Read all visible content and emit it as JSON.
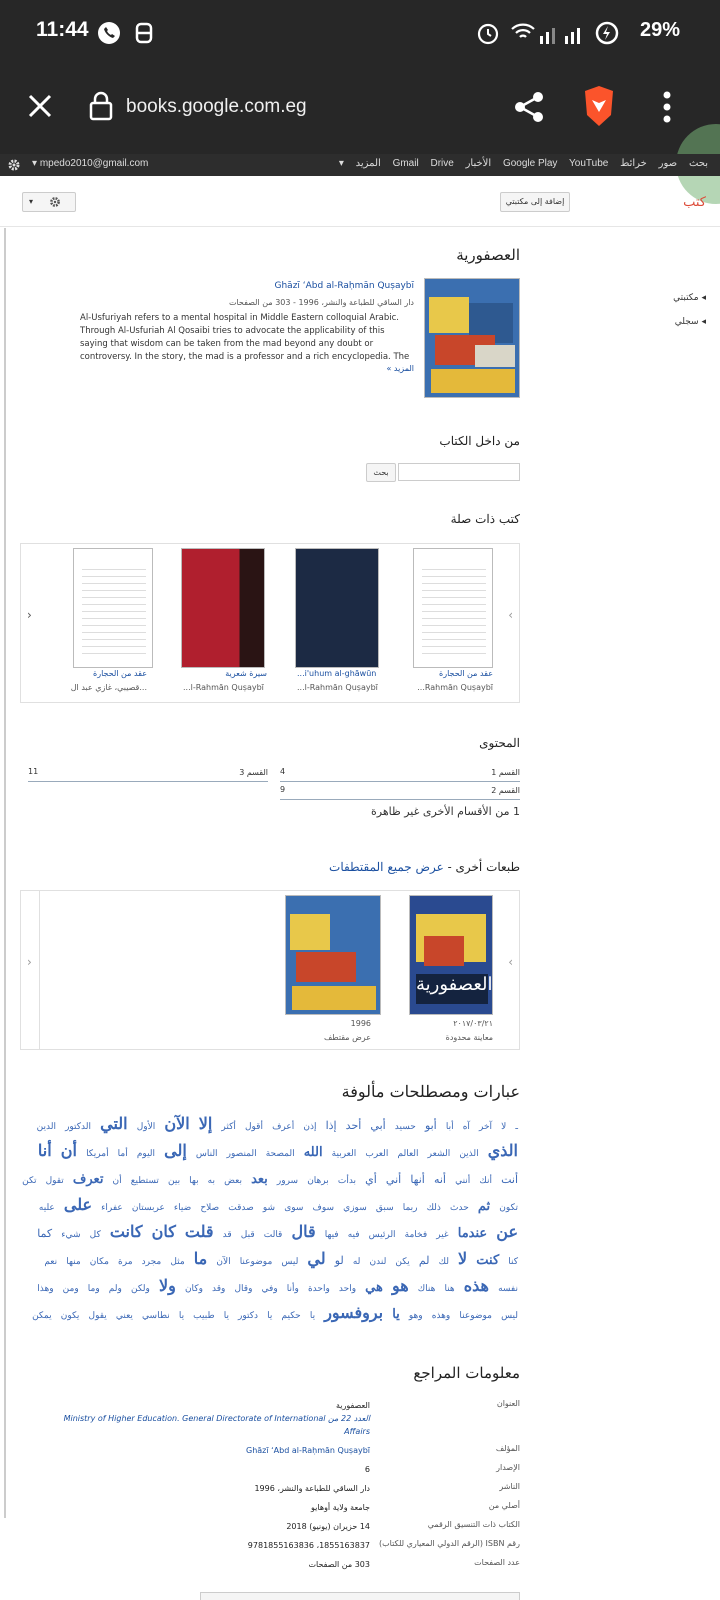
{
  "status": {
    "time": "11:44",
    "battery": "29%"
  },
  "browser": {
    "url": "books.google.com.eg"
  },
  "gbar": {
    "account": "mpedo2010@gmail.com",
    "items": [
      "بحث",
      "صور",
      "خرائط",
      "Google Play",
      "YouTube",
      "الأخبار",
      "Gmail",
      "Drive",
      "المزيد"
    ]
  },
  "header": {
    "logo": "كتب",
    "add_button": "إضافة إلى مكتبتي"
  },
  "sidebar": {
    "my_library": "مكتبتي",
    "history": "سجلي"
  },
  "book": {
    "title": "العصفورية",
    "author": "Ghāzī ʻAbd al-Raḥmān Quṣaybī",
    "meta": "دار الساقي للطباعة والنشر، 1996 - 303 من الصفحات",
    "description": "Al-Usfuriyah refers to a mental hospital in Middle Eastern colloquial Arabic. Through Al-Usfuriah Al Qosaibi tries to advocate the applicability of this saying that wisdom can be taken from the mad beyond any doubt or controversy. In the story, the mad is a professor and a rich encyclopedia. The mad is also a life",
    "more": "المزيد »"
  },
  "inside": {
    "heading": "من داخل الكتاب",
    "search_button": "بحث"
  },
  "related": {
    "heading": "كتب ذات صلة",
    "items": [
      {
        "title": "عقد من الحجارة",
        "author": "...Rahmān Quṣaybī"
      },
      {
        "title": "...i'uhum al-ghāwūn",
        "author": "...l-Rahmān Quṣaybī"
      },
      {
        "title": "سيرة شعرية",
        "author": "...l-Rahmān Quṣaybī"
      },
      {
        "title": "عقد من الحجارة",
        "author": "...قصيبي، غازي عبد ال"
      }
    ]
  },
  "contents": {
    "heading": "المحتوى",
    "rows": [
      {
        "label": "القسم 1",
        "page": "4"
      },
      {
        "label": "القسم 2",
        "page": "9"
      },
      {
        "label": "القسم 3",
        "page": "11"
      }
    ],
    "other": "1 من الأقسام الأخرى غير ظاهرة"
  },
  "editions": {
    "heading": "طبعات أخرى - ",
    "link": "عرض جميع المقتطفات",
    "items": [
      {
        "date": "٢٠١٧/٠٣/٢١",
        "note": "معاينة محدودة"
      },
      {
        "date": "1996",
        "note": "عرض مقتطف"
      }
    ]
  },
  "phrases": {
    "heading": "عبارات ومصطلحات مألوفة",
    "words": [
      [
        "ـ",
        0
      ],
      [
        "لا",
        0
      ],
      [
        "آخر",
        0
      ],
      [
        "آه",
        0
      ],
      [
        "أبا",
        0
      ],
      [
        "أبو",
        1
      ],
      [
        "حسيد",
        0
      ],
      [
        "أبي",
        1
      ],
      [
        "أحد",
        1
      ],
      [
        "إذا",
        1
      ],
      [
        "إذن",
        0
      ],
      [
        "أعرف",
        0
      ],
      [
        "أقول",
        0
      ],
      [
        "أكثر",
        0
      ],
      [
        "إلا",
        3
      ],
      [
        "الآن",
        3
      ],
      [
        "الأول",
        0
      ],
      [
        "التي",
        3
      ],
      [
        "الدكتور",
        0
      ],
      [
        "الدين",
        0
      ],
      [
        "الذي",
        3
      ],
      [
        "الذين",
        0
      ],
      [
        "الشعر",
        0
      ],
      [
        "العالم",
        0
      ],
      [
        "العرب",
        0
      ],
      [
        "العربية",
        0
      ],
      [
        "الله",
        2
      ],
      [
        "المصحة",
        0
      ],
      [
        "المنصور",
        0
      ],
      [
        "الناس",
        0
      ],
      [
        "إلى",
        3
      ],
      [
        "اليوم",
        0
      ],
      [
        "أما",
        0
      ],
      [
        "أمريكا",
        0
      ],
      [
        "أن",
        3
      ],
      [
        "أنا",
        3
      ],
      [
        "أنت",
        1
      ],
      [
        "أنك",
        0
      ],
      [
        "أنني",
        0
      ],
      [
        "أنه",
        1
      ],
      [
        "أنها",
        1
      ],
      [
        "أني",
        1
      ],
      [
        "أي",
        1
      ],
      [
        "بدأت",
        0
      ],
      [
        "برهان",
        0
      ],
      [
        "سرور",
        0
      ],
      [
        "بعد",
        2
      ],
      [
        "بعض",
        0
      ],
      [
        "به",
        0
      ],
      [
        "بها",
        0
      ],
      [
        "بين",
        0
      ],
      [
        "تستطيع",
        0
      ],
      [
        "أن",
        0
      ],
      [
        "تعرف",
        2
      ],
      [
        "تقول",
        0
      ],
      [
        "تكن",
        0
      ],
      [
        "تكون",
        0
      ],
      [
        "ثم",
        2
      ],
      [
        "حدث",
        0
      ],
      [
        "ذلك",
        0
      ],
      [
        "ربما",
        0
      ],
      [
        "سبق",
        0
      ],
      [
        "سوزي",
        0
      ],
      [
        "سوف",
        0
      ],
      [
        "سوى",
        0
      ],
      [
        "شو",
        0
      ],
      [
        "صدقت",
        0
      ],
      [
        "صلاح",
        0
      ],
      [
        "ضياء",
        0
      ],
      [
        "عربستان",
        0
      ],
      [
        "عفراء",
        0
      ],
      [
        "على",
        3
      ],
      [
        "عليه",
        0
      ],
      [
        "عن",
        3
      ],
      [
        "عندما",
        2
      ],
      [
        "غير",
        0
      ],
      [
        "فخامة",
        0
      ],
      [
        "الرئيس",
        0
      ],
      [
        "فيه",
        0
      ],
      [
        "فيها",
        0
      ],
      [
        "قال",
        3
      ],
      [
        "قالت",
        0
      ],
      [
        "قبل",
        0
      ],
      [
        "قد",
        0
      ],
      [
        "قلت",
        3
      ],
      [
        "كان",
        3
      ],
      [
        "كانت",
        3
      ],
      [
        "كل",
        0
      ],
      [
        "شيء",
        0
      ],
      [
        "كما",
        1
      ],
      [
        "كنا",
        0
      ],
      [
        "كنت",
        2
      ],
      [
        "لا",
        3
      ],
      [
        "لك",
        0
      ],
      [
        "لم",
        1
      ],
      [
        "يكن",
        0
      ],
      [
        "لندن",
        0
      ],
      [
        "له",
        0
      ],
      [
        "لو",
        1
      ],
      [
        "لي",
        3
      ],
      [
        "ليس",
        0
      ],
      [
        "موضوعنا",
        0
      ],
      [
        "الآن",
        0
      ],
      [
        "ما",
        3
      ],
      [
        "مثل",
        0
      ],
      [
        "مجرد",
        0
      ],
      [
        "مرة",
        0
      ],
      [
        "مكان",
        0
      ],
      [
        "منها",
        0
      ],
      [
        "نعم",
        0
      ],
      [
        "نفسه",
        0
      ],
      [
        "هذه",
        3
      ],
      [
        "هنا",
        0
      ],
      [
        "هناك",
        0
      ],
      [
        "هو",
        3
      ],
      [
        "هي",
        2
      ],
      [
        "واحد",
        0
      ],
      [
        "واحدة",
        0
      ],
      [
        "وأنا",
        0
      ],
      [
        "وفي",
        0
      ],
      [
        "وقال",
        0
      ],
      [
        "وقد",
        0
      ],
      [
        "وكان",
        0
      ],
      [
        "ولا",
        3
      ],
      [
        "ولكن",
        0
      ],
      [
        "ولم",
        0
      ],
      [
        "وما",
        0
      ],
      [
        "ومن",
        0
      ],
      [
        "وهذا",
        0
      ],
      [
        "ليس",
        0
      ],
      [
        "موضوعنا",
        0
      ],
      [
        "وهذه",
        0
      ],
      [
        "وهو",
        0
      ],
      [
        "يا",
        2
      ],
      [
        "بروفسور",
        3
      ],
      [
        "يا",
        0
      ],
      [
        "حكيم",
        0
      ],
      [
        "يا",
        0
      ],
      [
        "دكتور",
        0
      ],
      [
        "يا",
        0
      ],
      [
        "طبيب",
        0
      ],
      [
        "يا",
        0
      ],
      [
        "نطاسي",
        0
      ],
      [
        "يعني",
        0
      ],
      [
        "يقول",
        0
      ],
      [
        "يكون",
        0
      ],
      [
        "يمكن",
        0
      ],
      [
        "يوم",
        0
      ]
    ]
  },
  "references": {
    "heading": "معلومات المراجع",
    "rows": [
      {
        "label": "العنوان",
        "values": [
          "العصفورية",
          "العدد 22 من Ministry of Higher Education. General Directorate of International Affairs"
        ]
      },
      {
        "label": "المؤلف",
        "values": [
          "Ghāzī ʻAbd al-Raḥmān Quṣaybī"
        ]
      },
      {
        "label": "الإصدار",
        "values": [
          "6"
        ]
      },
      {
        "label": "الناشر",
        "values": [
          "دار الساقي للطباعة والنشر، 1996"
        ]
      },
      {
        "label": "أصلي من",
        "values": [
          "جامعة ولاية أوهايو"
        ]
      },
      {
        "label": "الكتاب ذات التنسيق الرقمي",
        "values": [
          "14 حزيران (يونيو) 2018"
        ]
      },
      {
        "label": "رقم ISBN (الرقم الدولي المعياري للكتاب)",
        "values": [
          "1855163837، 9781855163836"
        ]
      },
      {
        "label": "عدد الصفحات",
        "values": [
          "303 من الصفحات"
        ]
      }
    ]
  },
  "colors": {
    "accent": "#dd4b39",
    "link": "#1a4fa0",
    "brave": "#fb542b"
  }
}
